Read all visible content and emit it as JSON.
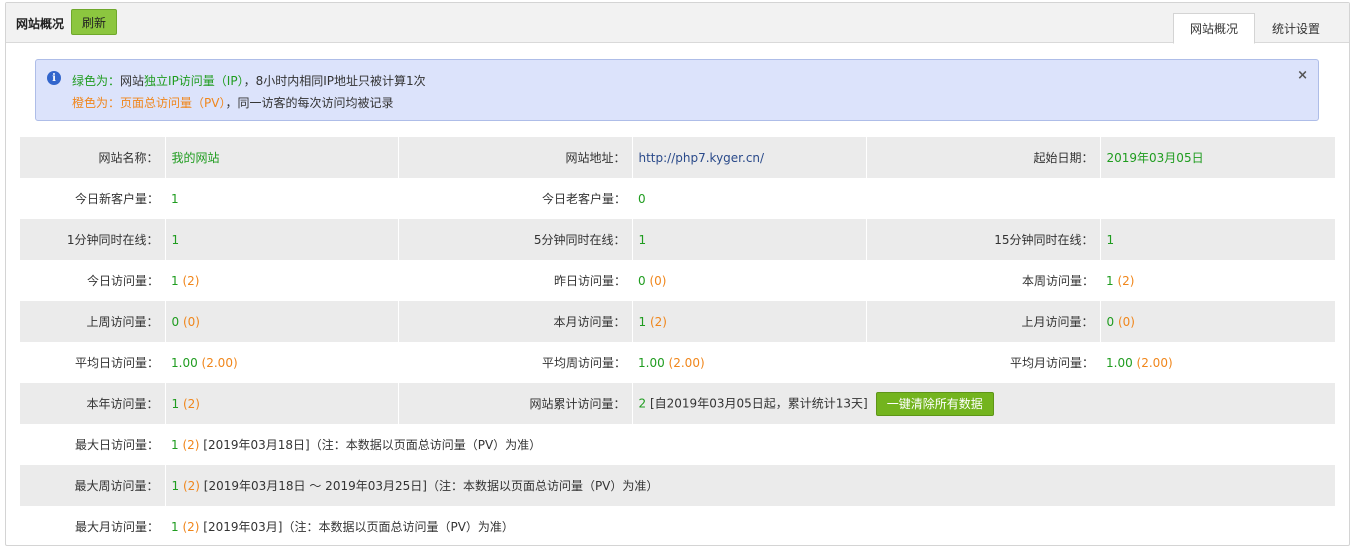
{
  "header": {
    "title": "网站概况",
    "refresh_label": "刷新",
    "tabs": [
      {
        "label": "网站概况",
        "active": true
      },
      {
        "label": "统计设置",
        "active": false
      }
    ]
  },
  "alert": {
    "line1": {
      "prefix": "绿色为：",
      "pre": "网站",
      "hl": "独立IP访问量（IP）",
      "rest": "，8小时内相同IP地址只被计算1次"
    },
    "line2": {
      "prefix": "橙色为：",
      "hl": "页面总访问量（PV）",
      "rest": "，同一访客的每次访问均被记录"
    },
    "close": "×"
  },
  "site": {
    "name_label": "网站名称：",
    "name": "我的网站",
    "url_label": "网站地址：",
    "url": "http://php7.kyger.cn/",
    "start_label": "起始日期：",
    "start": "2019年03月05日"
  },
  "customers": {
    "new_label": "今日新客户量：",
    "new": "1",
    "old_label": "今日老客户量：",
    "old": "0"
  },
  "online": {
    "m1_label": "1分钟同时在线：",
    "m1": "1",
    "m5_label": "5分钟同时在线：",
    "m5": "1",
    "m15_label": "15分钟同时在线：",
    "m15": "1"
  },
  "visits": {
    "today_label": "今日访问量：",
    "today_ip": "1",
    "today_pv": "(2)",
    "yesterday_label": "昨日访问量：",
    "yesterday_ip": "0",
    "yesterday_pv": "(0)",
    "week_label": "本周访问量：",
    "week_ip": "1",
    "week_pv": "(2)",
    "lastweek_label": "上周访问量：",
    "lastweek_ip": "0",
    "lastweek_pv": "(0)",
    "month_label": "本月访问量：",
    "month_ip": "1",
    "month_pv": "(2)",
    "lastmonth_label": "上月访问量：",
    "lastmonth_ip": "0",
    "lastmonth_pv": "(0)",
    "avgday_label": "平均日访问量：",
    "avgday_ip": "1.00",
    "avgday_pv": "(2.00)",
    "avgweek_label": "平均周访问量：",
    "avgweek_ip": "1.00",
    "avgweek_pv": "(2.00)",
    "avgmonth_label": "平均月访问量：",
    "avgmonth_ip": "1.00",
    "avgmonth_pv": "(2.00)",
    "year_label": "本年访问量：",
    "year_ip": "1",
    "year_pv": "(2)",
    "total_label": "网站累计访问量：",
    "total_ip": "2",
    "total_note": "[自2019年03月05日起，累计统计13天]",
    "clear_label": "一键清除所有数据"
  },
  "max": {
    "day_label": "最大日访问量：",
    "day_ip": "1",
    "day_pv": "(2)",
    "day_note": "[2019年03月18日]（注：本数据以页面总访问量（PV）为准）",
    "week_label": "最大周访问量：",
    "week_ip": "1",
    "week_pv": "(2)",
    "week_note": "[2019年03月18日 ～ 2019年03月25日]（注：本数据以页面总访问量（PV）为准）",
    "month_label": "最大月访问量：",
    "month_ip": "1",
    "month_pv": "(2)",
    "month_note": "[2019年03月]（注：本数据以页面总访问量（PV）为准）"
  }
}
